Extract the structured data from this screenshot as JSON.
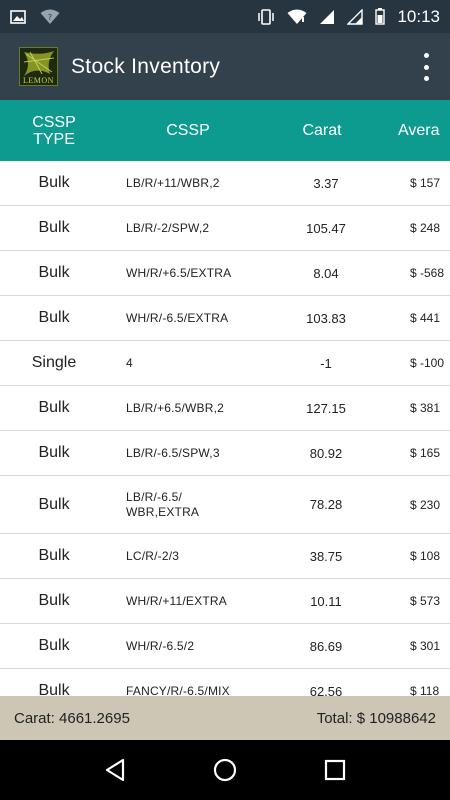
{
  "status_bar": {
    "time": "10:13",
    "icons": [
      "image-icon",
      "wifi-question-icon",
      "vibrate-icon",
      "wifi-icon",
      "signal-icon",
      "signal-icon",
      "battery-icon"
    ]
  },
  "app_bar": {
    "logo_text": "LEMON",
    "title": "Stock Inventory"
  },
  "table": {
    "headers": {
      "type": "CSSP TYPE",
      "cssp": "CSSP",
      "carat": "Carat",
      "avg": "Avera"
    },
    "rows": [
      {
        "type": "Bulk",
        "cssp": "LB/R/+11/WBR,2",
        "carat": "3.37",
        "avg": "$ 157"
      },
      {
        "type": "Bulk",
        "cssp": "LB/R/-2/SPW,2",
        "carat": "105.47",
        "avg": "$ 248"
      },
      {
        "type": "Bulk",
        "cssp": "WH/R/+6.5/EXTRA",
        "carat": "8.04",
        "avg": "$ -568"
      },
      {
        "type": "Bulk",
        "cssp": "WH/R/-6.5/EXTRA",
        "carat": "103.83",
        "avg": "$ 441"
      },
      {
        "type": "Single",
        "cssp": "4",
        "carat": "-1",
        "avg": "$ -100"
      },
      {
        "type": "Bulk",
        "cssp": "LB/R/+6.5/WBR,2",
        "carat": "127.15",
        "avg": "$ 381"
      },
      {
        "type": "Bulk",
        "cssp": "LB/R/-6.5/SPW,3",
        "carat": "80.92",
        "avg": "$ 165"
      },
      {
        "type": "Bulk",
        "cssp": "LB/R/-6.5/ WBR,EXTRA",
        "carat": "78.28",
        "avg": "$ 230"
      },
      {
        "type": "Bulk",
        "cssp": "LC/R/-2/3",
        "carat": "38.75",
        "avg": "$ 108"
      },
      {
        "type": "Bulk",
        "cssp": "WH/R/+11/EXTRA",
        "carat": "10.11",
        "avg": "$ 573"
      },
      {
        "type": "Bulk",
        "cssp": "WH/R/-6.5/2",
        "carat": "86.69",
        "avg": "$ 301"
      },
      {
        "type": "Bulk",
        "cssp": "FANCY/R/-6.5/MIX",
        "carat": "62.56",
        "avg": "$ 118"
      }
    ]
  },
  "footer": {
    "carat": "Carat: 4661.2695",
    "total": "Total: $ 10988642"
  },
  "nav_bar": {
    "buttons": [
      "back-icon",
      "home-icon",
      "recents-icon"
    ]
  },
  "colors": {
    "status_bar": "#263540",
    "app_bar": "#33414d",
    "table_header": "#0c9b8e",
    "footer": "#cdc6b5",
    "nav_bar": "#000000"
  }
}
